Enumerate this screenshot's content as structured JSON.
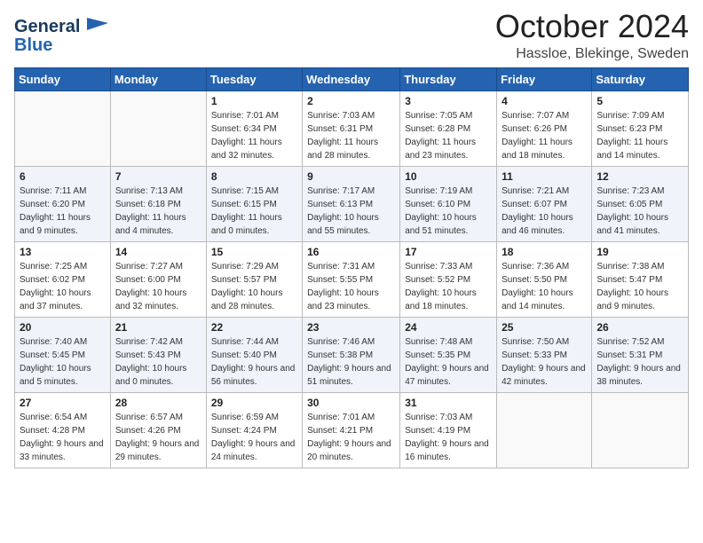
{
  "header": {
    "logo_line1": "General",
    "logo_line2": "Blue",
    "month": "October 2024",
    "location": "Hassloe, Blekinge, Sweden"
  },
  "days_of_week": [
    "Sunday",
    "Monday",
    "Tuesday",
    "Wednesday",
    "Thursday",
    "Friday",
    "Saturday"
  ],
  "weeks": [
    [
      {
        "day": "",
        "sunrise": "",
        "sunset": "",
        "daylight": ""
      },
      {
        "day": "",
        "sunrise": "",
        "sunset": "",
        "daylight": ""
      },
      {
        "day": "1",
        "sunrise": "Sunrise: 7:01 AM",
        "sunset": "Sunset: 6:34 PM",
        "daylight": "Daylight: 11 hours and 32 minutes."
      },
      {
        "day": "2",
        "sunrise": "Sunrise: 7:03 AM",
        "sunset": "Sunset: 6:31 PM",
        "daylight": "Daylight: 11 hours and 28 minutes."
      },
      {
        "day": "3",
        "sunrise": "Sunrise: 7:05 AM",
        "sunset": "Sunset: 6:28 PM",
        "daylight": "Daylight: 11 hours and 23 minutes."
      },
      {
        "day": "4",
        "sunrise": "Sunrise: 7:07 AM",
        "sunset": "Sunset: 6:26 PM",
        "daylight": "Daylight: 11 hours and 18 minutes."
      },
      {
        "day": "5",
        "sunrise": "Sunrise: 7:09 AM",
        "sunset": "Sunset: 6:23 PM",
        "daylight": "Daylight: 11 hours and 14 minutes."
      }
    ],
    [
      {
        "day": "6",
        "sunrise": "Sunrise: 7:11 AM",
        "sunset": "Sunset: 6:20 PM",
        "daylight": "Daylight: 11 hours and 9 minutes."
      },
      {
        "day": "7",
        "sunrise": "Sunrise: 7:13 AM",
        "sunset": "Sunset: 6:18 PM",
        "daylight": "Daylight: 11 hours and 4 minutes."
      },
      {
        "day": "8",
        "sunrise": "Sunrise: 7:15 AM",
        "sunset": "Sunset: 6:15 PM",
        "daylight": "Daylight: 11 hours and 0 minutes."
      },
      {
        "day": "9",
        "sunrise": "Sunrise: 7:17 AM",
        "sunset": "Sunset: 6:13 PM",
        "daylight": "Daylight: 10 hours and 55 minutes."
      },
      {
        "day": "10",
        "sunrise": "Sunrise: 7:19 AM",
        "sunset": "Sunset: 6:10 PM",
        "daylight": "Daylight: 10 hours and 51 minutes."
      },
      {
        "day": "11",
        "sunrise": "Sunrise: 7:21 AM",
        "sunset": "Sunset: 6:07 PM",
        "daylight": "Daylight: 10 hours and 46 minutes."
      },
      {
        "day": "12",
        "sunrise": "Sunrise: 7:23 AM",
        "sunset": "Sunset: 6:05 PM",
        "daylight": "Daylight: 10 hours and 41 minutes."
      }
    ],
    [
      {
        "day": "13",
        "sunrise": "Sunrise: 7:25 AM",
        "sunset": "Sunset: 6:02 PM",
        "daylight": "Daylight: 10 hours and 37 minutes."
      },
      {
        "day": "14",
        "sunrise": "Sunrise: 7:27 AM",
        "sunset": "Sunset: 6:00 PM",
        "daylight": "Daylight: 10 hours and 32 minutes."
      },
      {
        "day": "15",
        "sunrise": "Sunrise: 7:29 AM",
        "sunset": "Sunset: 5:57 PM",
        "daylight": "Daylight: 10 hours and 28 minutes."
      },
      {
        "day": "16",
        "sunrise": "Sunrise: 7:31 AM",
        "sunset": "Sunset: 5:55 PM",
        "daylight": "Daylight: 10 hours and 23 minutes."
      },
      {
        "day": "17",
        "sunrise": "Sunrise: 7:33 AM",
        "sunset": "Sunset: 5:52 PM",
        "daylight": "Daylight: 10 hours and 18 minutes."
      },
      {
        "day": "18",
        "sunrise": "Sunrise: 7:36 AM",
        "sunset": "Sunset: 5:50 PM",
        "daylight": "Daylight: 10 hours and 14 minutes."
      },
      {
        "day": "19",
        "sunrise": "Sunrise: 7:38 AM",
        "sunset": "Sunset: 5:47 PM",
        "daylight": "Daylight: 10 hours and 9 minutes."
      }
    ],
    [
      {
        "day": "20",
        "sunrise": "Sunrise: 7:40 AM",
        "sunset": "Sunset: 5:45 PM",
        "daylight": "Daylight: 10 hours and 5 minutes."
      },
      {
        "day": "21",
        "sunrise": "Sunrise: 7:42 AM",
        "sunset": "Sunset: 5:43 PM",
        "daylight": "Daylight: 10 hours and 0 minutes."
      },
      {
        "day": "22",
        "sunrise": "Sunrise: 7:44 AM",
        "sunset": "Sunset: 5:40 PM",
        "daylight": "Daylight: 9 hours and 56 minutes."
      },
      {
        "day": "23",
        "sunrise": "Sunrise: 7:46 AM",
        "sunset": "Sunset: 5:38 PM",
        "daylight": "Daylight: 9 hours and 51 minutes."
      },
      {
        "day": "24",
        "sunrise": "Sunrise: 7:48 AM",
        "sunset": "Sunset: 5:35 PM",
        "daylight": "Daylight: 9 hours and 47 minutes."
      },
      {
        "day": "25",
        "sunrise": "Sunrise: 7:50 AM",
        "sunset": "Sunset: 5:33 PM",
        "daylight": "Daylight: 9 hours and 42 minutes."
      },
      {
        "day": "26",
        "sunrise": "Sunrise: 7:52 AM",
        "sunset": "Sunset: 5:31 PM",
        "daylight": "Daylight: 9 hours and 38 minutes."
      }
    ],
    [
      {
        "day": "27",
        "sunrise": "Sunrise: 6:54 AM",
        "sunset": "Sunset: 4:28 PM",
        "daylight": "Daylight: 9 hours and 33 minutes."
      },
      {
        "day": "28",
        "sunrise": "Sunrise: 6:57 AM",
        "sunset": "Sunset: 4:26 PM",
        "daylight": "Daylight: 9 hours and 29 minutes."
      },
      {
        "day": "29",
        "sunrise": "Sunrise: 6:59 AM",
        "sunset": "Sunset: 4:24 PM",
        "daylight": "Daylight: 9 hours and 24 minutes."
      },
      {
        "day": "30",
        "sunrise": "Sunrise: 7:01 AM",
        "sunset": "Sunset: 4:21 PM",
        "daylight": "Daylight: 9 hours and 20 minutes."
      },
      {
        "day": "31",
        "sunrise": "Sunrise: 7:03 AM",
        "sunset": "Sunset: 4:19 PM",
        "daylight": "Daylight: 9 hours and 16 minutes."
      },
      {
        "day": "",
        "sunrise": "",
        "sunset": "",
        "daylight": ""
      },
      {
        "day": "",
        "sunrise": "",
        "sunset": "",
        "daylight": ""
      }
    ]
  ]
}
